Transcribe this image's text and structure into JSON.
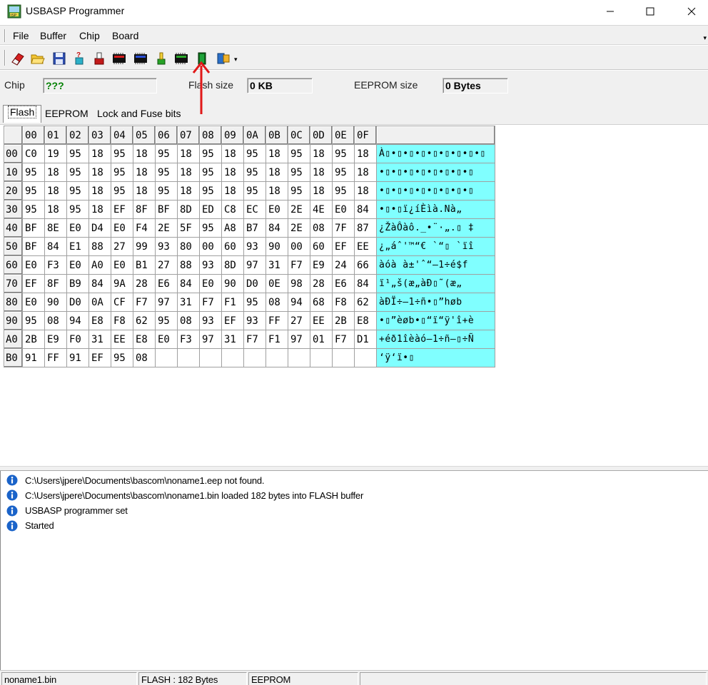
{
  "window": {
    "title": "USBASP Programmer"
  },
  "menu": {
    "items": [
      "File",
      "Buffer",
      "Chip",
      "Board"
    ]
  },
  "toolbar": {
    "icons": [
      "erase-chip-icon",
      "open-file-icon",
      "save-file-icon",
      "verify-icon",
      "blank-check-icon",
      "write-chip-icon",
      "read-chip-icon",
      "program-icon",
      "chip-id-icon",
      "autoprogram-icon",
      "options-icon"
    ]
  },
  "info": {
    "chip_label": "Chip",
    "chip_value": "???",
    "flash_label": "Flash size",
    "flash_value": "0 KB",
    "eeprom_label": "EEPROM size",
    "eeprom_value": "0 Bytes"
  },
  "tabs": {
    "flash": "Flash",
    "eeprom": "EEPROM",
    "fuses": "Lock and Fuse bits"
  },
  "hex": {
    "columns": [
      "00",
      "01",
      "02",
      "03",
      "04",
      "05",
      "06",
      "07",
      "08",
      "09",
      "0A",
      "0B",
      "0C",
      "0D",
      "0E",
      "0F"
    ],
    "rows": [
      {
        "addr": "00",
        "cells": [
          "C0",
          "19",
          "95",
          "18",
          "95",
          "18",
          "95",
          "18",
          "95",
          "18",
          "95",
          "18",
          "95",
          "18",
          "95",
          "18"
        ],
        "ascii": "À\u0019•\u0018•\u0018•\u0018•\u0018•\u0018•\u0018•\u0018•\u0018"
      },
      {
        "addr": "10",
        "cells": [
          "95",
          "18",
          "95",
          "18",
          "95",
          "18",
          "95",
          "18",
          "95",
          "18",
          "95",
          "18",
          "95",
          "18",
          "95",
          "18"
        ],
        "ascii": "•\u0018•\u0018•\u0018•\u0018•\u0018•\u0018•\u0018•\u0018"
      },
      {
        "addr": "20",
        "cells": [
          "95",
          "18",
          "95",
          "18",
          "95",
          "18",
          "95",
          "18",
          "95",
          "18",
          "95",
          "18",
          "95",
          "18",
          "95",
          "18"
        ],
        "ascii": "•\u0018•\u0018•\u0018•\u0018•\u0018•\u0018•\u0018•\u0018"
      },
      {
        "addr": "30",
        "cells": [
          "95",
          "18",
          "95",
          "18",
          "EF",
          "8F",
          "BF",
          "8D",
          "ED",
          "C8",
          "EC",
          "E0",
          "2E",
          "4E",
          "E0",
          "84"
        ],
        "ascii": "•\u0018•\u0018ï¿íÈìà.Nà„"
      },
      {
        "addr": "40",
        "cells": [
          "BF",
          "8E",
          "E0",
          "D4",
          "E0",
          "F4",
          "2E",
          "5F",
          "95",
          "A8",
          "B7",
          "84",
          "2E",
          "08",
          "7F",
          "87"
        ],
        "ascii": "¿ŽàÔàô._•¨·„.\b ‡"
      },
      {
        "addr": "50",
        "cells": [
          "BF",
          "84",
          "E1",
          "88",
          "27",
          "99",
          "93",
          "80",
          "00",
          "60",
          "93",
          "90",
          "00",
          "60",
          "EF",
          "EE"
        ],
        "ascii": "¿„áˆ'™“€ `“\u0000 `ïî"
      },
      {
        "addr": "60",
        "cells": [
          "E0",
          "F3",
          "E0",
          "A0",
          "E0",
          "B1",
          "27",
          "88",
          "93",
          "8D",
          "97",
          "31",
          "F7",
          "E9",
          "24",
          "66"
        ],
        "ascii": "àóà à±'ˆ“—1÷é$f"
      },
      {
        "addr": "70",
        "cells": [
          "EF",
          "8F",
          "B9",
          "84",
          "9A",
          "28",
          "E6",
          "84",
          "E0",
          "90",
          "D0",
          "0E",
          "98",
          "28",
          "E6",
          "84"
        ],
        "ascii": "ï¹„š(æ„àÐ\u000e˜(æ„"
      },
      {
        "addr": "80",
        "cells": [
          "E0",
          "90",
          "D0",
          "0A",
          "CF",
          "F7",
          "97",
          "31",
          "F7",
          "F1",
          "95",
          "08",
          "94",
          "68",
          "F8",
          "62"
        ],
        "ascii": "àÐÏ÷—1÷ñ•\b”høb"
      },
      {
        "addr": "90",
        "cells": [
          "95",
          "08",
          "94",
          "E8",
          "F8",
          "62",
          "95",
          "08",
          "93",
          "EF",
          "93",
          "FF",
          "27",
          "EE",
          "2B",
          "E8"
        ],
        "ascii": "•\b”èøb•\b“ï“ÿ'î+è"
      },
      {
        "addr": "A0",
        "cells": [
          "2B",
          "E9",
          "F0",
          "31",
          "EE",
          "E8",
          "E0",
          "F3",
          "97",
          "31",
          "F7",
          "F1",
          "97",
          "01",
          "F7",
          "D1"
        ],
        "ascii": "+éð1îèàó—1÷ñ—\u0001÷Ñ"
      },
      {
        "addr": "B0",
        "cells": [
          "91",
          "FF",
          "91",
          "EF",
          "95",
          "08",
          "",
          "",
          "",
          "",
          "",
          "",
          "",
          "",
          "",
          ""
        ],
        "ascii": "‘ÿ‘ï•\b"
      }
    ]
  },
  "log": [
    "C:\\Users\\jpere\\Documents\\bascom\\noname1.eep not found.",
    "C:\\Users\\jpere\\Documents\\bascom\\noname1.bin loaded 182 bytes into FLASH buffer",
    "USBASP programmer set",
    "Started"
  ],
  "status": {
    "file": "noname1.bin",
    "flash": "FLASH : 182 Bytes",
    "eeprom": "EEPROM",
    "extra": ""
  },
  "colors": {
    "ascii_bg": "#80ffff",
    "chip_value": "#008000",
    "annotation_arrow": "#e01818"
  }
}
